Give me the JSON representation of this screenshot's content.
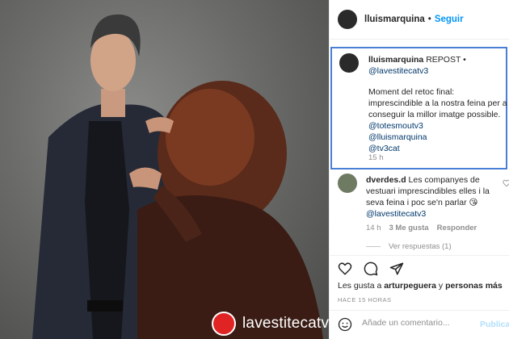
{
  "post": {
    "watermark": "lavestitecatv3"
  },
  "header": {
    "username": "lluismarquina",
    "separator": "•",
    "follow_label": "Seguir"
  },
  "caption": {
    "username": "lluismarquina",
    "repost_label": "REPOST •",
    "mention_source": "@lavestitecatv3",
    "text": "Moment del retoc final: imprescindible a la nostra feina per a conseguir la millor imatge possible.",
    "mentions": [
      "@totesmoutv3",
      "@lluismarquina",
      "@tv3cat"
    ],
    "time": "15 h"
  },
  "comment": {
    "username": "dverdes.d",
    "text": "Les companyes de vestuari imprescindibles elles i la seva feina i poc se'n parlar 😘",
    "mention": "@lavestitecatv3",
    "time": "14 h",
    "likes": "3 Me gusta",
    "reply": "Responder",
    "view_replies": "Ver respuestas (1)"
  },
  "likes": {
    "prefix": "Les gusta a",
    "user": "arturpeguera",
    "conj": "y",
    "others": "personas más"
  },
  "timestamp": "HACE 15 HORAS",
  "composer": {
    "placeholder": "Añade un comentario...",
    "publish_label": "Publicar"
  },
  "icons": [
    "heart-icon",
    "comment-icon",
    "share-icon",
    "emoji-icon"
  ]
}
